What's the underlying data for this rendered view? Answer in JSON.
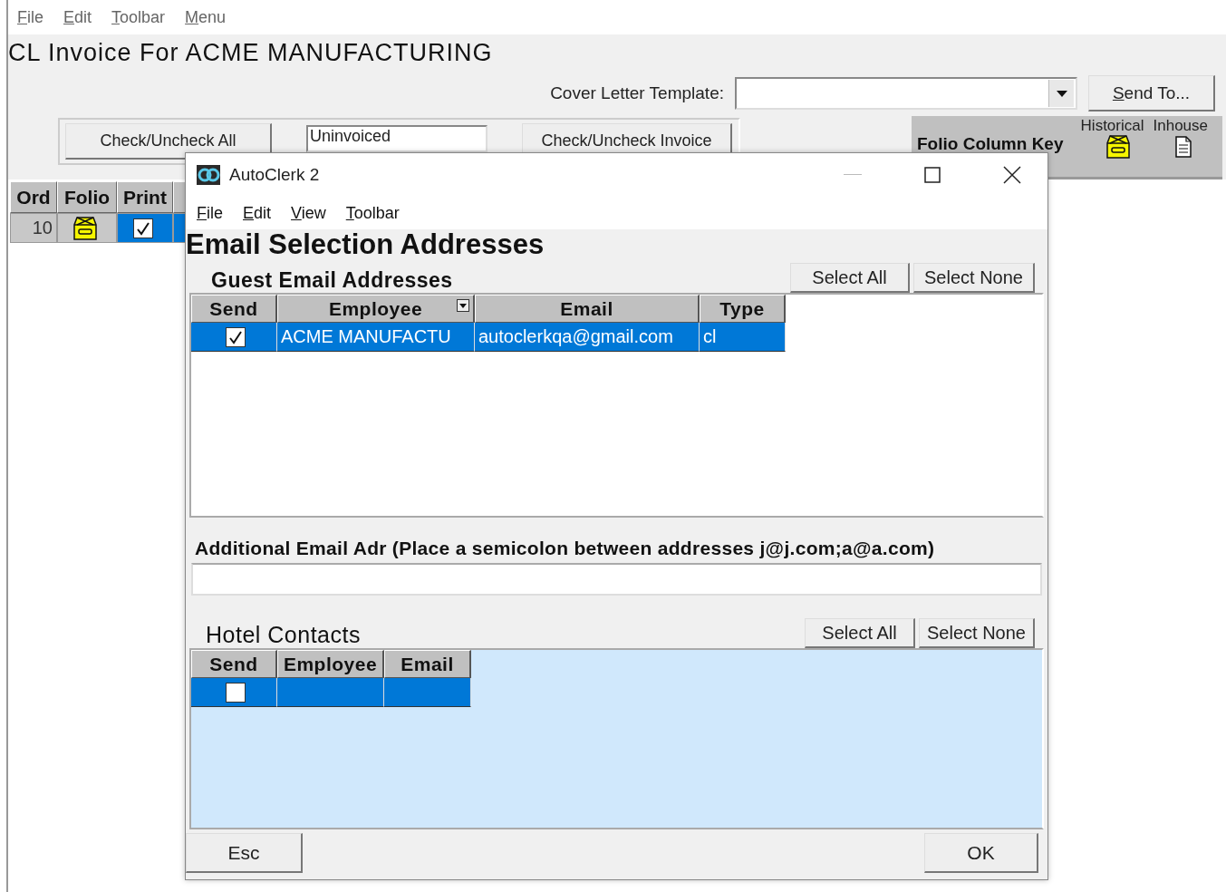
{
  "menu": [
    "File",
    "Edit",
    "Toolbar",
    "Menu"
  ],
  "title": "CL Invoice For ACME MANUFACTURING",
  "cover_letter": {
    "label": "Cover Letter Template:"
  },
  "send_button": "Send To...",
  "toolbar": {
    "check_all": "Check/Uncheck All",
    "filter": "Uninvoiced",
    "check_invoice": "Check/Uncheck Invoice"
  },
  "folio_key": {
    "title": "Folio Column Key",
    "columns": [
      "Historical",
      "Inhouse"
    ]
  },
  "table": {
    "columns": [
      "Ord",
      "Folio",
      "Print"
    ],
    "rows": [
      {
        "ord": "10",
        "print": true,
        "selected": true
      }
    ]
  },
  "dialog": {
    "title": "AutoClerk 2",
    "menu": [
      "File",
      "Edit",
      "View",
      "Toolbar"
    ],
    "heading": "Email Selection Addresses",
    "guest": {
      "heading": "Guest Email Addresses",
      "buttons": [
        "Select All",
        "Select None"
      ],
      "columns": [
        "Send",
        "Employee",
        "Email",
        "Type"
      ],
      "rows": [
        {
          "send": true,
          "employee": "ACME MANUFACTU",
          "email": "autoclerkqa@gmail.com",
          "type": "cl",
          "selected": true
        }
      ]
    },
    "additional": {
      "label": "Additional Email Adr (Place a semicolon between addresses  j@j.com;a@a.com)"
    },
    "hotel": {
      "heading": "Hotel Contacts",
      "buttons": [
        "Select All",
        "Select None"
      ],
      "columns": [
        "Send",
        "Employee",
        "Email"
      ],
      "rows": [
        {
          "send": false,
          "selected": true
        }
      ]
    },
    "buttons": [
      "Esc",
      "OK"
    ]
  }
}
